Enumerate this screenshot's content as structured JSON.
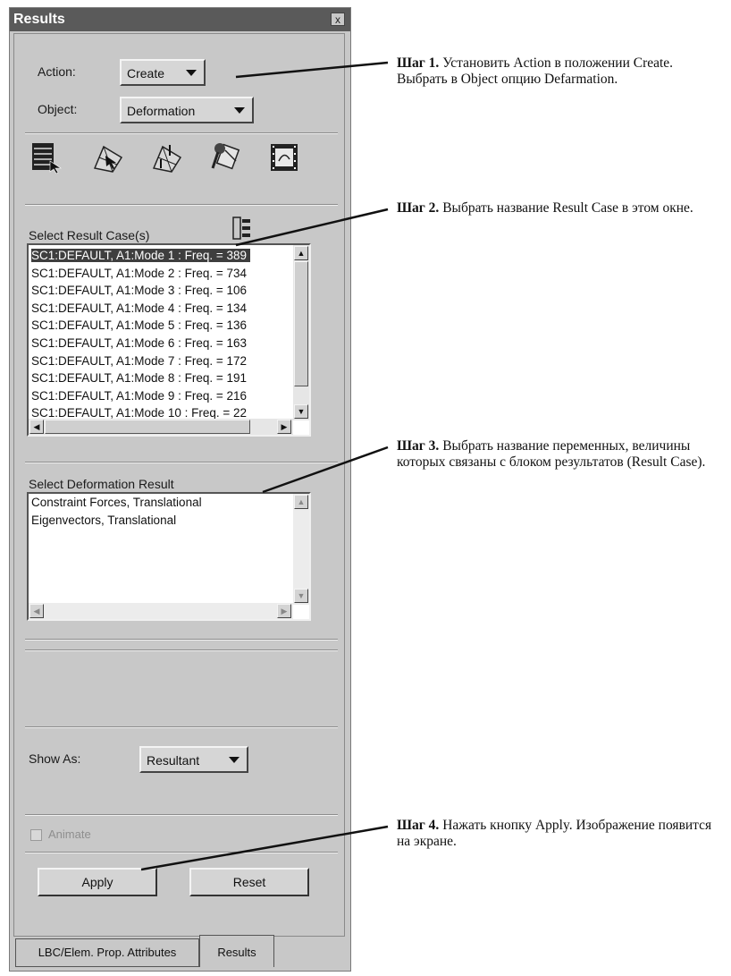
{
  "window": {
    "title": "Results",
    "close_glyph": "x"
  },
  "action": {
    "label": "Action:",
    "value": "Create"
  },
  "object": {
    "label": "Object:",
    "value": "Deformation"
  },
  "toolbar_icons": [
    "select-results-icon",
    "deform-plot-icon",
    "vector-plot-icon",
    "tools-icon",
    "animation-frame-icon"
  ],
  "result_cases": {
    "label": "Select Result Case(s)",
    "filter_icon": "tree-list-icon",
    "items": [
      "SC1:DEFAULT, A1:Mode 1 : Freq. = 389",
      "SC1:DEFAULT, A1:Mode 2 : Freq. = 734",
      "SC1:DEFAULT, A1:Mode 3 : Freq. = 106",
      "SC1:DEFAULT, A1:Mode 4 : Freq. = 134",
      "SC1:DEFAULT, A1:Mode 5 : Freq. = 136",
      "SC1:DEFAULT, A1:Mode 6 : Freq. = 163",
      "SC1:DEFAULT, A1:Mode 7 : Freq. = 172",
      "SC1:DEFAULT, A1:Mode 8 : Freq. = 191",
      "SC1:DEFAULT, A1:Mode 9 : Freq. = 216",
      "SC1:DEFAULT, A1:Mode 10 : Freq. = 22"
    ],
    "selected_index": 0
  },
  "deformation_result": {
    "label": "Select Deformation Result",
    "items": [
      "Constraint Forces, Translational",
      "Eigenvectors, Translational"
    ]
  },
  "show_as": {
    "label": "Show As:",
    "value": "Resultant"
  },
  "animate": {
    "label": "Animate",
    "checked": false
  },
  "buttons": {
    "apply": "Apply",
    "reset": "Reset"
  },
  "tabs": [
    "LBC/Elem. Prop. Attributes",
    "Results"
  ],
  "annotations": [
    {
      "step": "Шаг 1.",
      "text": "Установить Action в положении Create. Выбрать в Object опцию Defarmation."
    },
    {
      "step": "Шаг 2.",
      "text": "Выбрать название Result Case в этом окне."
    },
    {
      "step": "Шаг 3.",
      "text": "Выбрать название переменных, величины которых связаны с блоком результатов (Result Case)."
    },
    {
      "step": "Шаг 4.",
      "text": "Нажать кнопку Apply. Изображение появится на экране."
    }
  ]
}
